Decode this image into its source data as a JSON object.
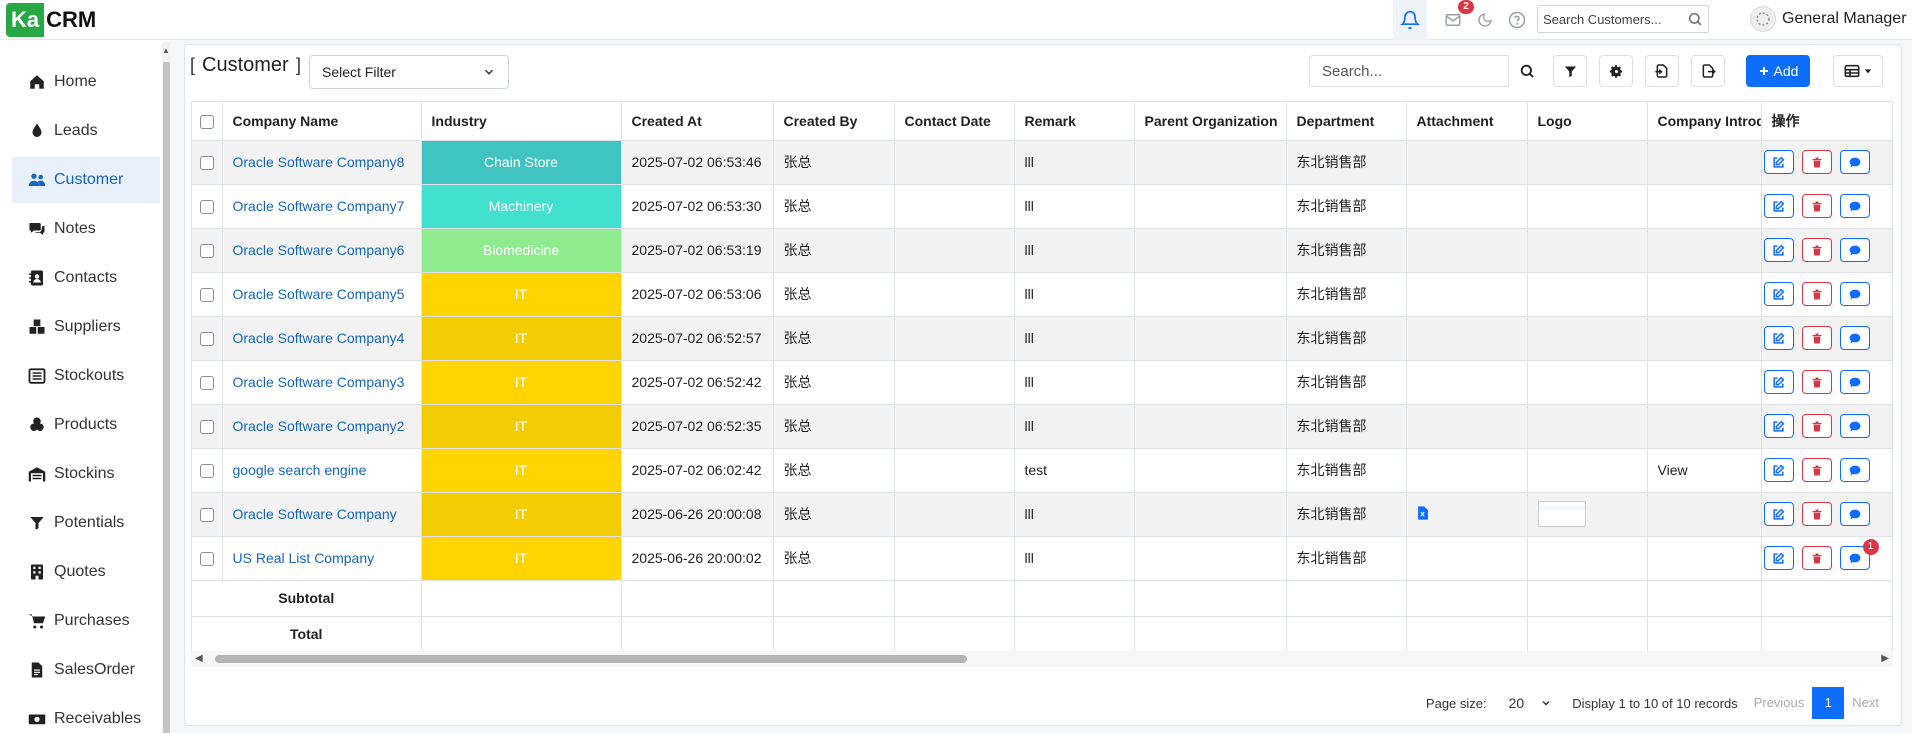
{
  "app": {
    "logo_prefix": "Ka",
    "logo_suffix": "CRM"
  },
  "topbar": {
    "mail_badge": "2",
    "search_placeholder": "Search Customers...",
    "user_name": "General Manager"
  },
  "sidebar": {
    "items": [
      {
        "label": "Home",
        "icon": "home-icon"
      },
      {
        "label": "Leads",
        "icon": "droplet-icon"
      },
      {
        "label": "Customer",
        "icon": "users-icon"
      },
      {
        "label": "Notes",
        "icon": "comments-icon"
      },
      {
        "label": "Contacts",
        "icon": "address-book-icon"
      },
      {
        "label": "Suppliers",
        "icon": "boxes-icon"
      },
      {
        "label": "Stockouts",
        "icon": "list-icon"
      },
      {
        "label": "Products",
        "icon": "cubes-icon"
      },
      {
        "label": "Stockins",
        "icon": "warehouse-icon"
      },
      {
        "label": "Potentials",
        "icon": "funnel-icon"
      },
      {
        "label": "Quotes",
        "icon": "building-icon"
      },
      {
        "label": "Purchases",
        "icon": "cart-icon"
      },
      {
        "label": "SalesOrder",
        "icon": "file-icon"
      },
      {
        "label": "Receivables",
        "icon": "money-icon"
      }
    ],
    "active": "Customer"
  },
  "page": {
    "title": "Customer",
    "bracket_open": "[",
    "bracket_close": "]",
    "filter_select": "Select Filter",
    "search_placeholder": "Search...",
    "add_label": "Add"
  },
  "table": {
    "columns": [
      "Company Name",
      "Industry",
      "Created At",
      "Created By",
      "Contact Date",
      "Remark",
      "Parent Organization",
      "Department",
      "Attachment",
      "Logo",
      "Company Introduction",
      "操作"
    ],
    "rows": [
      {
        "company": "Oracle Software Company8",
        "industry": "Chain Store",
        "industry_color": "#40c4c1",
        "created_at": "2025-07-02 06:53:46",
        "created_by": "张总",
        "remark": "lll",
        "department": "东北销售部",
        "intro": "",
        "attachment": false,
        "logo": false,
        "chat_badge": ""
      },
      {
        "company": "Oracle Software Company7",
        "industry": "Machinery",
        "industry_color": "#42e0cf",
        "created_at": "2025-07-02 06:53:30",
        "created_by": "张总",
        "remark": "lll",
        "department": "东北销售部",
        "intro": "",
        "attachment": false,
        "logo": false,
        "chat_badge": ""
      },
      {
        "company": "Oracle Software Company6",
        "industry": "Biomedicine",
        "industry_color": "#8eeb8e",
        "created_at": "2025-07-02 06:53:19",
        "created_by": "张总",
        "remark": "lll",
        "department": "东北销售部",
        "intro": "",
        "attachment": false,
        "logo": false,
        "chat_badge": ""
      },
      {
        "company": "Oracle Software Company5",
        "industry": "IT",
        "industry_color": "#ffd400",
        "created_at": "2025-07-02 06:53:06",
        "created_by": "张总",
        "remark": "lll",
        "department": "东北销售部",
        "intro": "",
        "attachment": false,
        "logo": false,
        "chat_badge": ""
      },
      {
        "company": "Oracle Software Company4",
        "industry": "IT",
        "industry_color": "#f2cb00",
        "created_at": "2025-07-02 06:52:57",
        "created_by": "张总",
        "remark": "lll",
        "department": "东北销售部",
        "intro": "",
        "attachment": false,
        "logo": false,
        "chat_badge": ""
      },
      {
        "company": "Oracle Software Company3",
        "industry": "IT",
        "industry_color": "#ffd400",
        "created_at": "2025-07-02 06:52:42",
        "created_by": "张总",
        "remark": "lll",
        "department": "东北销售部",
        "intro": "",
        "attachment": false,
        "logo": false,
        "chat_badge": ""
      },
      {
        "company": "Oracle Software Company2",
        "industry": "IT",
        "industry_color": "#f2cb00",
        "created_at": "2025-07-02 06:52:35",
        "created_by": "张总",
        "remark": "lll",
        "department": "东北销售部",
        "intro": "",
        "attachment": false,
        "logo": false,
        "chat_badge": ""
      },
      {
        "company": "google search engine",
        "industry": "IT",
        "industry_color": "#ffd400",
        "created_at": "2025-07-02 06:02:42",
        "created_by": "张总",
        "remark": "test",
        "department": "东北销售部",
        "intro": "View",
        "attachment": false,
        "logo": false,
        "chat_badge": ""
      },
      {
        "company": "Oracle Software Company",
        "industry": "IT",
        "industry_color": "#f2cb00",
        "created_at": "2025-06-26 20:00:08",
        "created_by": "张总",
        "remark": "lll",
        "department": "东北销售部",
        "intro": "",
        "attachment": true,
        "logo": true,
        "chat_badge": ""
      },
      {
        "company": "US Real List Company",
        "industry": "IT",
        "industry_color": "#ffd400",
        "created_at": "2025-06-26 20:00:02",
        "created_by": "张总",
        "remark": "lll",
        "department": "东北销售部",
        "intro": "",
        "attachment": false,
        "logo": false,
        "chat_badge": "1"
      }
    ],
    "subtotal_label": "Subtotal",
    "total_label": "Total"
  },
  "pager": {
    "page_size_label": "Page size:",
    "page_size": "20",
    "display": "Display 1 to 10 of 10 records",
    "previous": "Previous",
    "current": "1",
    "next": "Next"
  },
  "colors": {
    "primary": "#0d6efd",
    "danger": "#dc3545",
    "link": "#1565c0",
    "logo_green": "#28a745"
  }
}
